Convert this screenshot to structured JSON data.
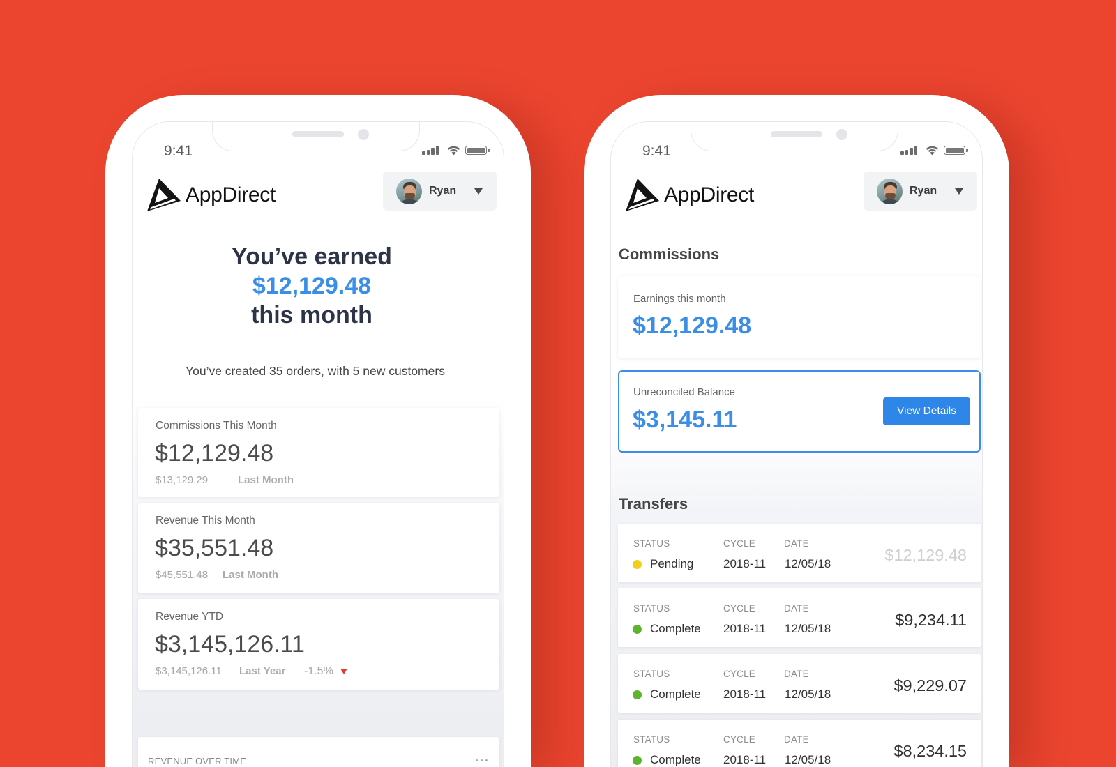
{
  "colors": {
    "background": "#EB452F",
    "accent_blue": "#3A8EE6",
    "button_blue": "#2F86E9",
    "heading_navy": "#2D3447",
    "status_pending": "#F0D01C",
    "status_complete": "#5DB52E",
    "negative_change": "#E53935"
  },
  "app": {
    "status_time": "9:41",
    "brand_name": "AppDirect",
    "user_name": "Ryan"
  },
  "icons": {
    "logo": "appdirect-logo-icon",
    "user_menu_toggle": "caret-down-icon",
    "signal": "cellular-signal-icon",
    "wifi": "wifi-icon",
    "battery": "battery-icon",
    "chart_menu": "more-horizontal-icon",
    "change_indicator": "triangle-down-icon"
  },
  "dashboard": {
    "hero": {
      "line1": "You’ve earned",
      "amount": "$12,129.48",
      "line3": "this month"
    },
    "summary": "You’ve created 35 orders, with 5 new customers",
    "stats": [
      {
        "title": "Commissions This Month",
        "value": "$12,129.48",
        "compare_value": "$13,129.29",
        "compare_label": "Last Month"
      },
      {
        "title": "Revenue This Month",
        "value": "$35,551.48",
        "compare_value": "$45,551.48",
        "compare_label": "Last Month"
      },
      {
        "title": "Revenue YTD",
        "value": "$3,145,126.11",
        "compare_value": "$3,145,126.11",
        "compare_label": "Last Year",
        "change": "-1.5%"
      }
    ],
    "revenue_chart": {
      "title": "REVENUE OVER TIME"
    }
  },
  "commissions": {
    "heading": "Commissions",
    "earnings": {
      "label": "Earnings this month",
      "value": "$12,129.48"
    },
    "unreconciled": {
      "label": "Unreconciled Balance",
      "value": "$3,145.11",
      "button_label": "View Details"
    }
  },
  "transfers": {
    "heading": "Transfers",
    "columns": {
      "status": "STATUS",
      "cycle": "CYCLE",
      "date": "DATE"
    },
    "rows": [
      {
        "status": "Pending",
        "status_color": "#F0D01C",
        "cycle": "2018-11",
        "date": "12/05/18",
        "amount": "$12,129.48"
      },
      {
        "status": "Complete",
        "status_color": "#5DB52E",
        "cycle": "2018-11",
        "date": "12/05/18",
        "amount": "$9,234.11"
      },
      {
        "status": "Complete",
        "status_color": "#5DB52E",
        "cycle": "2018-11",
        "date": "12/05/18",
        "amount": "$9,229.07"
      },
      {
        "status": "Complete",
        "status_color": "#5DB52E",
        "cycle": "2018-11",
        "date": "12/05/18",
        "amount": "$8,234.15"
      }
    ]
  }
}
